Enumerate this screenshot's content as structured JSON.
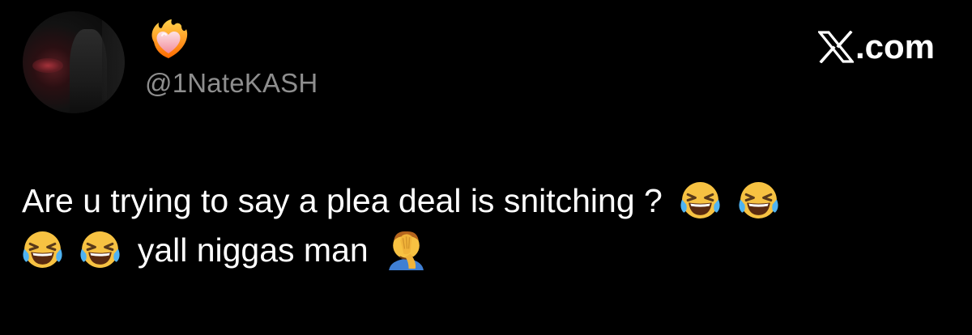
{
  "post": {
    "avatar_icon": "profile-photo",
    "badge_emoji": "❤️‍🔥",
    "badge_icon": "heart-on-fire-icon",
    "handle": "@1NateKASH",
    "line1_text": "Are u trying to say a plea deal is snitching ?",
    "line2_text": "yall niggas man",
    "emojis": {
      "laughing": "😂",
      "facepalm": "🤦‍♂️"
    }
  },
  "watermark": {
    "logo_icon": "x-logo-icon",
    "text": ".com"
  },
  "colors": {
    "background": "#000000",
    "text": "#ffffff",
    "handle": "#8e8e8e",
    "emoji_yellow": "#f7c242",
    "heart_red": "#f5b0b8"
  }
}
